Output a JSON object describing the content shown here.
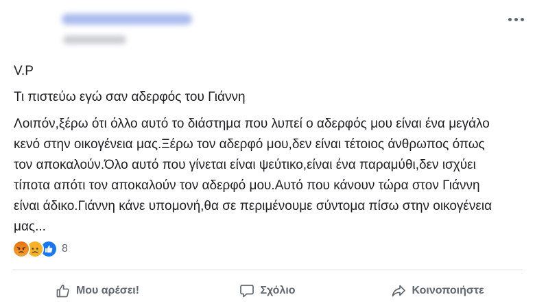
{
  "post": {
    "line1": "V.P",
    "line2": "Τι πιστεύω εγώ σαν αδερφός του Γιάννη",
    "body": "Λοιπόν,ξέρω ότι όλλο αυτό το διάστημα που λυπεί ο αδερφός μου είναι ένα μεγάλο κενό στην οικογένεια μας.Ξέρω τον αδερφό μου,δεν είναι τέτοιος άνθρωπος όπως τον αποκαλούν.Όλο αυτό που γίνεται είναι ψεύτικο,είναι ένα παραμύθι,δεν ισχύει τίποτα απότι τον αποκαλούν τον αδερφό μου.Αυτό που κάνουν τώρα στον Γιάννη είναι άδικο.Γιάννη κάνε υπομονή,θα σε περιμένουμε σύντομα πίσω στην οικογένεια μας..."
  },
  "reactions": {
    "icons": [
      "angry-icon",
      "sad-icon",
      "like-icon"
    ],
    "count": "8"
  },
  "actions": {
    "like": "Μου αρέσει!",
    "comment": "Σχόλιο",
    "share": "Κοινοποιήστε"
  },
  "colors": {
    "angry": "#e9710f",
    "sad": "#f7b125",
    "like": "#1877f2",
    "action_text": "#606770"
  }
}
